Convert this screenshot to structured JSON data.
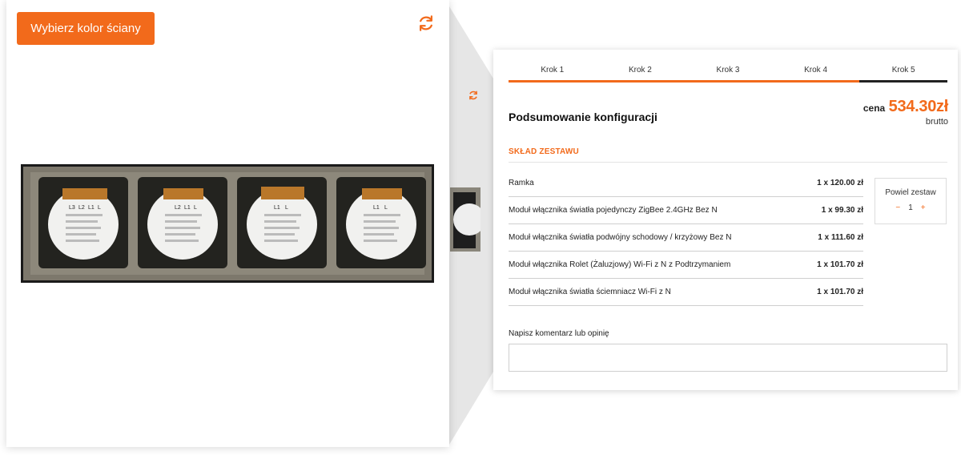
{
  "left": {
    "wall_color_button": "Wybierz kolor ściany",
    "product_labels": [
      "L3",
      "L2",
      "L1",
      "L",
      "L2",
      "L1",
      "L",
      "L1",
      "L",
      "L1",
      "L"
    ]
  },
  "tabs": [
    {
      "label": "Krok 1"
    },
    {
      "label": "Krok 2"
    },
    {
      "label": "Krok 3"
    },
    {
      "label": "Krok 4"
    },
    {
      "label": "Krok 5"
    }
  ],
  "summary": {
    "title": "Podsumowanie konfiguracji",
    "price_label": "cena",
    "price_value": "534.30zł",
    "price_gross": "brutto",
    "section_title": "SKŁAD ZESTAWU"
  },
  "items": [
    {
      "name": "Ramka",
      "qty": "1 x 120.00 zł"
    },
    {
      "name": "Moduł włącznika światła pojedynczy ZigBee 2.4GHz Bez N",
      "qty": "1 x 99.30 zł"
    },
    {
      "name": "Moduł włącznika światła podwójny schodowy / krzyżowy Bez N",
      "qty": "1 x 111.60 zł"
    },
    {
      "name": "Moduł włącznika Rolet (Żaluzjowy) Wi-Fi z N z Podtrzymaniem",
      "qty": "1 x 101.70 zł"
    },
    {
      "name": "Moduł włącznika światła ściemniacz Wi-Fi z N",
      "qty": "1 x 101.70 zł"
    }
  ],
  "multiplier": {
    "label": "Powiel zestaw",
    "minus": "−",
    "value": "1",
    "plus": "+"
  },
  "comment": {
    "label": "Napisz komentarz lub opinię",
    "placeholder": ""
  },
  "colors": {
    "accent": "#f26a1b",
    "active_tab": "#222222"
  },
  "icons": [
    "refresh-icon"
  ]
}
